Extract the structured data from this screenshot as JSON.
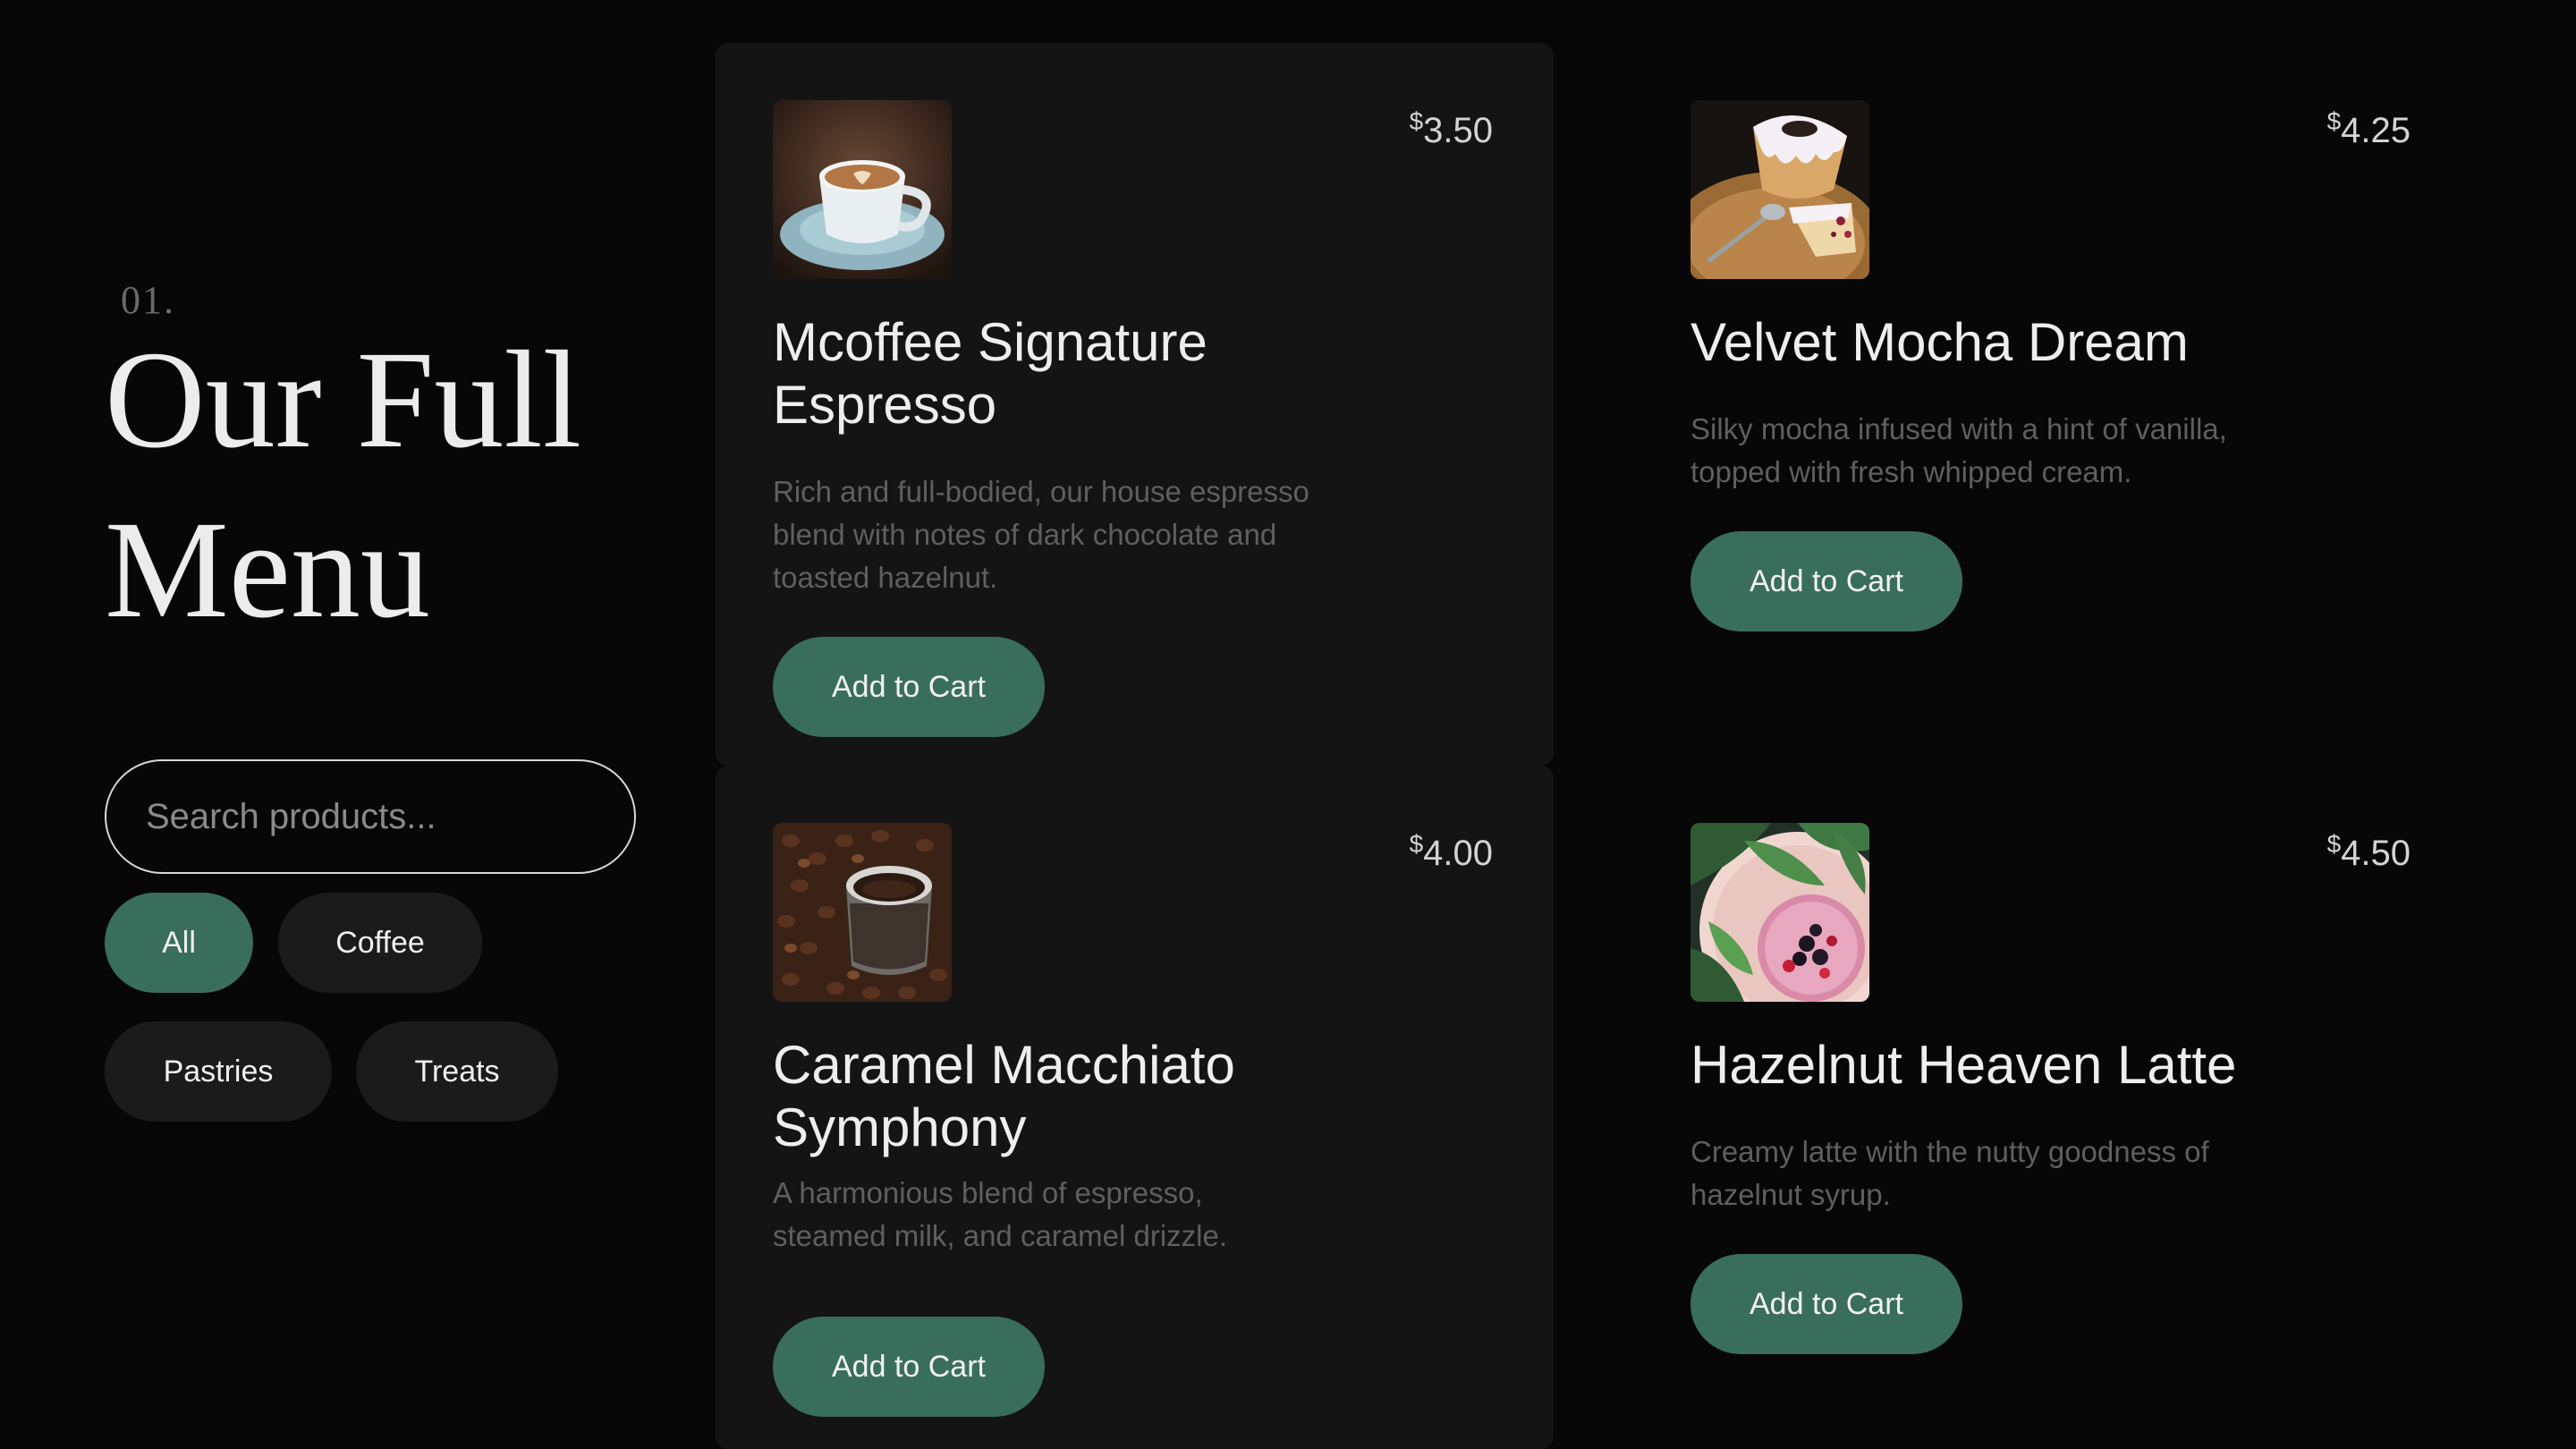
{
  "section": {
    "number": "01.",
    "title": "Our Full Menu"
  },
  "search": {
    "placeholder": "Search products...",
    "value": ""
  },
  "filters": {
    "active": "All",
    "items": [
      {
        "label": "All"
      },
      {
        "label": "Coffee"
      },
      {
        "label": "Pastries"
      },
      {
        "label": "Treats"
      }
    ]
  },
  "products": [
    {
      "name": "Mcoffee Signature Espresso",
      "description": "Rich and full-bodied, our house espresso blend with notes of dark chocolate and toasted hazelnut.",
      "currency": "$",
      "price": "3.50",
      "image_icon": "espresso-cup-image",
      "button_label": "Add to Cart"
    },
    {
      "name": "Velvet Mocha Dream",
      "description": "Silky mocha infused with a hint of vanilla, topped with fresh whipped cream.",
      "currency": "$",
      "price": "4.25",
      "image_icon": "bundt-cake-image",
      "button_label": "Add to Cart"
    },
    {
      "name": "Caramel Macchiato Symphony",
      "description": "A harmonious blend of espresso, steamed milk, and caramel drizzle.",
      "currency": "$",
      "price": "4.00",
      "image_icon": "coffee-grounds-image",
      "button_label": "Add to Cart"
    },
    {
      "name": "Hazelnut Heaven Latte",
      "description": "Creamy latte with the nutty goodness of hazelnut syrup.",
      "currency": "$",
      "price": "4.50",
      "image_icon": "berry-smoothie-image",
      "button_label": "Add to Cart"
    }
  ],
  "colors": {
    "accent": "#3a6e5c",
    "background": "#070707",
    "card": "#141414",
    "chip": "#1b1b1b"
  }
}
